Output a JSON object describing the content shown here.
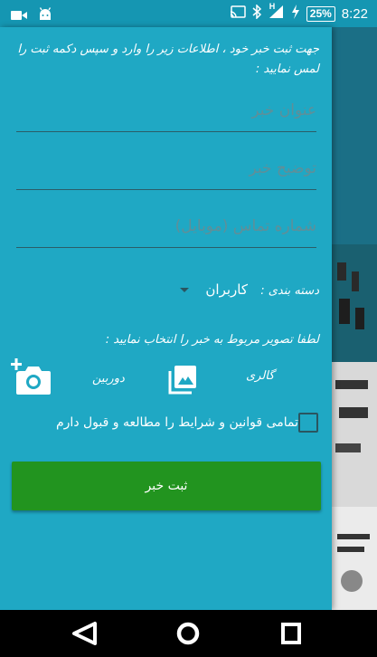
{
  "status_bar": {
    "battery": "25%",
    "time": "8:22",
    "signal_type": "H",
    "icons": [
      "camera-icon",
      "android-icon",
      "cast-icon",
      "bluetooth-icon",
      "signal-icon",
      "charging-icon",
      "battery-icon"
    ]
  },
  "drawer": {
    "intro": "جهت ثبت خبر خود ، اطلاعات زیر را وارد و سپس دکمه ثبت را لمس نمایید :",
    "fields": {
      "title_placeholder": "عنوان خبر",
      "description_placeholder": "توضیح خبر",
      "phone_placeholder": "شماره تماس (موبایل)"
    },
    "category": {
      "label": "دسته بندی :",
      "selected": "کاربران"
    },
    "image_prompt": "لطفا تصویر مربوط به خبر را انتخاب نمایید :",
    "camera_label": "دوربین",
    "gallery_label": "گالری",
    "terms_label": "تمامی قوانین و شرایط را مطالعه و قبول دارم",
    "submit_label": "ثبت خبر"
  },
  "colors": {
    "drawer_bg": "#1fa8c4",
    "status_bar": "#1596b2",
    "submit_button": "#22941f"
  }
}
